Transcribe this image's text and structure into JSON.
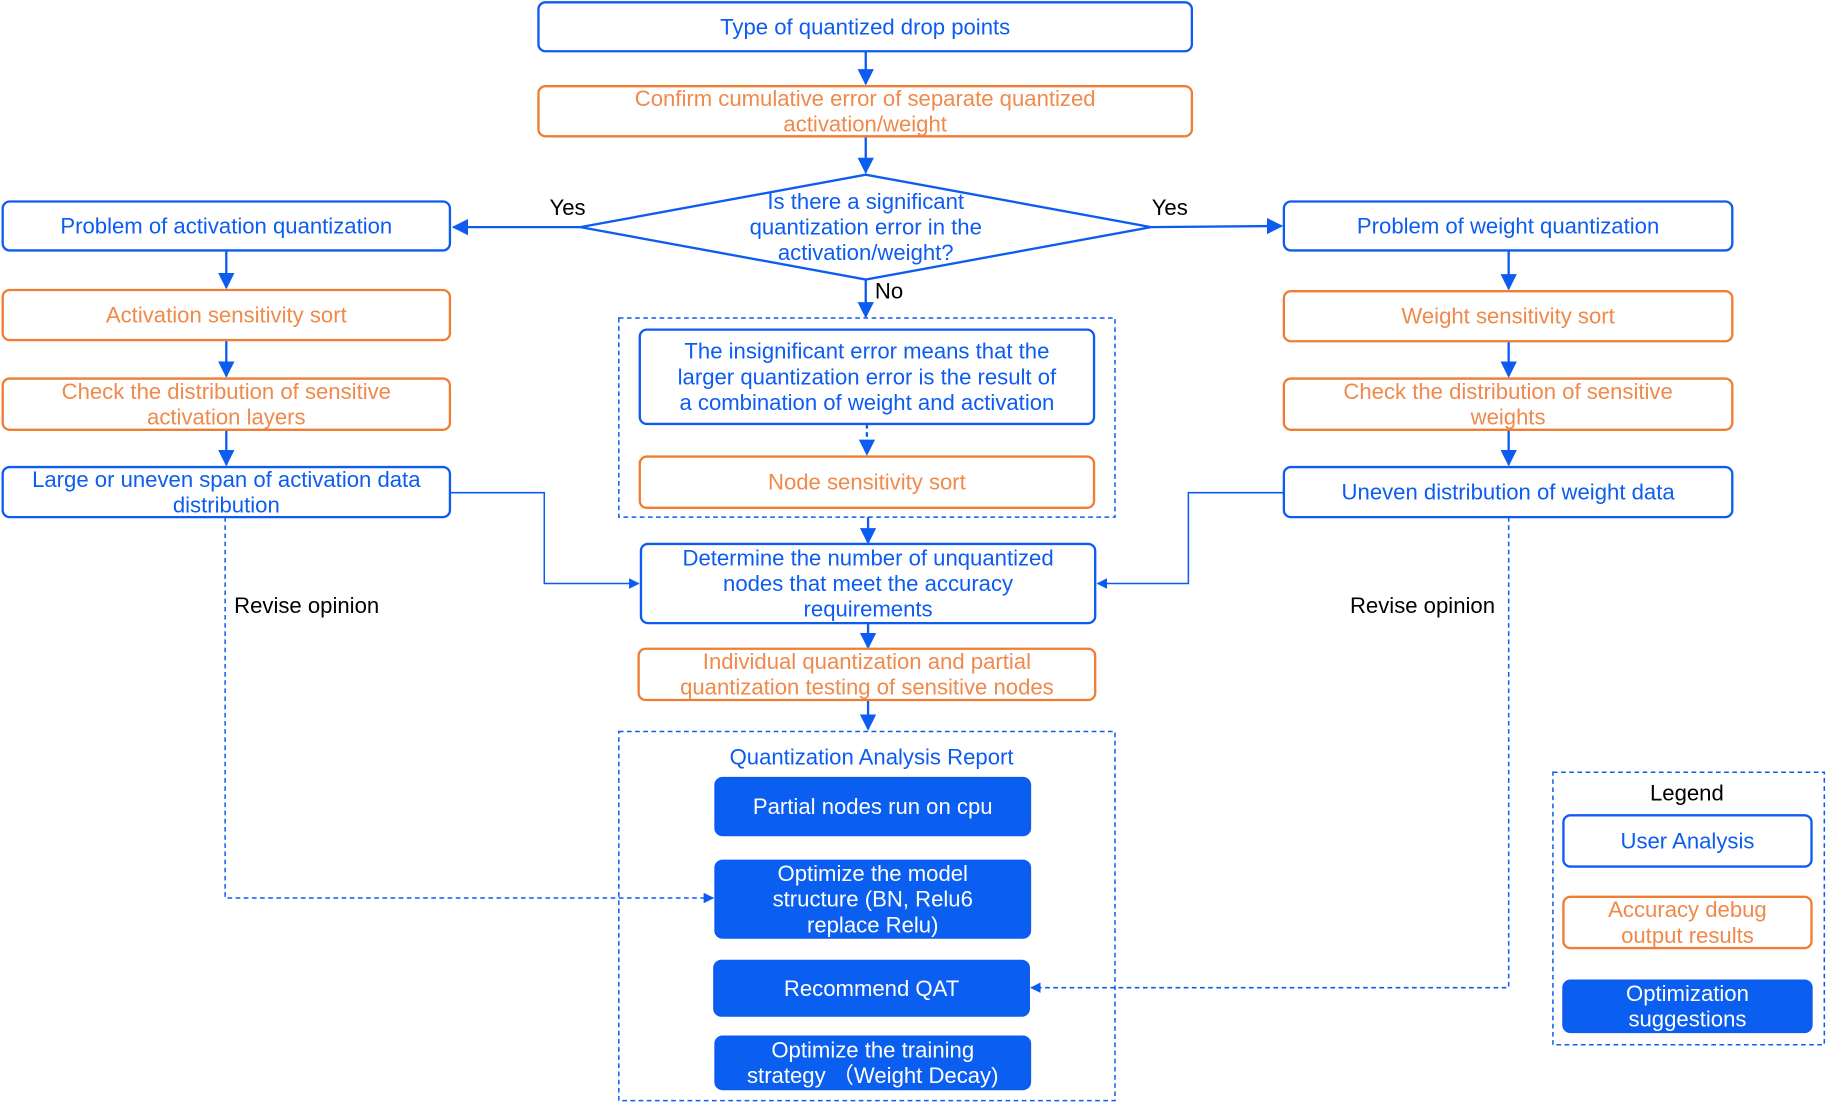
{
  "colors": {
    "blue": "#0d5cf2",
    "orange": "#ef7d34",
    "orange_text": "#f0894a",
    "fill": "#0a5ef0",
    "label": "#000000"
  },
  "nodes": {
    "type_drop": {
      "kind": "blue",
      "lines": [
        "Type of quantized drop points"
      ]
    },
    "confirm_error": {
      "kind": "orange",
      "lines": [
        "Confirm cumulative error of separate quantized",
        "activation/weight"
      ]
    },
    "decision": {
      "kind": "diamond",
      "lines": [
        "Is there a significant",
        "quantization error in the",
        "activation/weight?"
      ]
    },
    "act_problem": {
      "kind": "blue",
      "lines": [
        "Problem of activation quantization"
      ]
    },
    "act_sort": {
      "kind": "orange",
      "lines": [
        "Activation sensitivity sort"
      ]
    },
    "act_check": {
      "kind": "orange",
      "lines": [
        "Check the distribution of sensitive",
        "activation layers"
      ]
    },
    "act_span": {
      "kind": "blue",
      "lines": [
        "Large or uneven span of activation data",
        "distribution"
      ]
    },
    "w_problem": {
      "kind": "blue",
      "lines": [
        "Problem of weight quantization"
      ]
    },
    "w_sort": {
      "kind": "orange",
      "lines": [
        "Weight sensitivity sort"
      ]
    },
    "w_check": {
      "kind": "orange",
      "lines": [
        "Check the distribution of sensitive",
        "weights"
      ]
    },
    "w_uneven": {
      "kind": "blue",
      "lines": [
        "Uneven distribution of weight data"
      ]
    },
    "insignificant": {
      "kind": "blue",
      "lines": [
        "The insignificant error means that the",
        "larger quantization error is the result of",
        "a combination of weight and activation"
      ]
    },
    "node_sort": {
      "kind": "orange",
      "lines": [
        "Node sensitivity sort"
      ]
    },
    "determine": {
      "kind": "blue",
      "lines": [
        "Determine the number of unquantized",
        "nodes that meet the accuracy",
        "requirements"
      ]
    },
    "individual": {
      "kind": "orange",
      "lines": [
        "Individual quantization and partial",
        "quantization testing of sensitive nodes"
      ]
    },
    "cpu": {
      "kind": "fill",
      "lines": [
        "Partial nodes run on cpu"
      ]
    },
    "optimize_model": {
      "kind": "fill",
      "lines": [
        "Optimize the model",
        "structure (BN, Relu6",
        "replace Relu)"
      ]
    },
    "qat": {
      "kind": "fill",
      "lines": [
        "Recommend QAT"
      ]
    },
    "training": {
      "kind": "fill",
      "lines": [
        "Optimize the training",
        "strategy （Weight Decay)"
      ]
    },
    "legend_user": {
      "kind": "blue",
      "lines": [
        "User Analysis"
      ]
    },
    "legend_debug": {
      "kind": "orange",
      "lines": [
        "Accuracy debug",
        "output results"
      ]
    },
    "legend_opt": {
      "kind": "fill",
      "lines": [
        "Optimization",
        "suggestions"
      ]
    }
  },
  "labels": {
    "yes_left": "Yes",
    "yes_right": "Yes",
    "no": "No",
    "revise_left": "Revise opinion",
    "revise_right": "Revise opinion",
    "report_title": "Quantization Analysis Report",
    "legend_title": "Legend"
  }
}
